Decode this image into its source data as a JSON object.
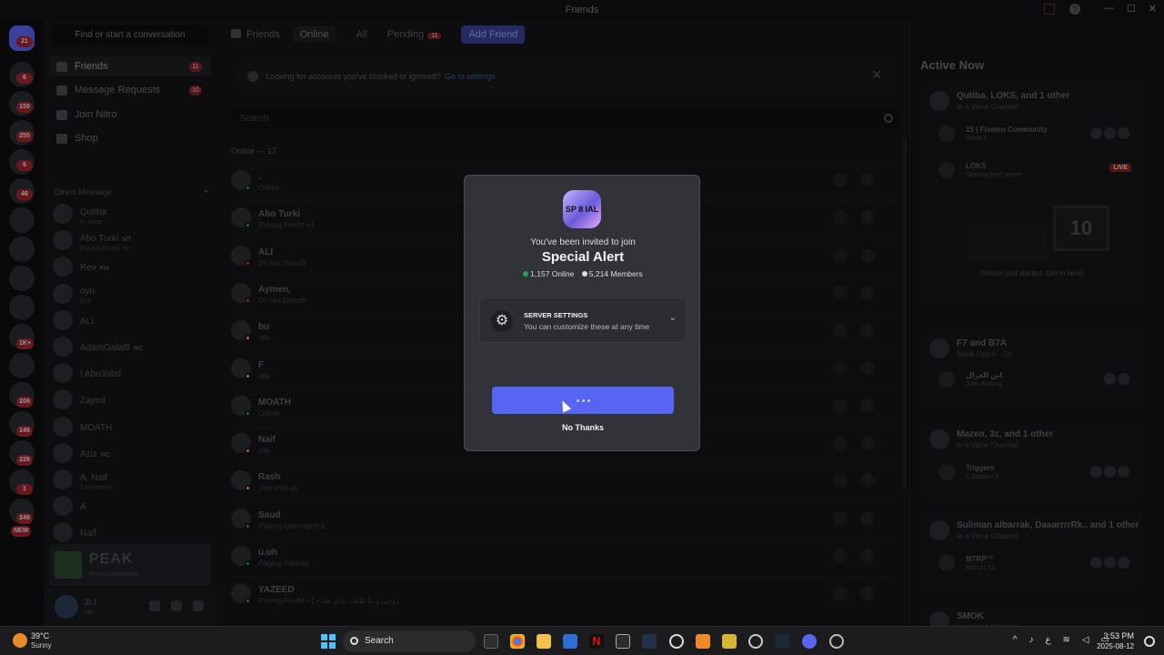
{
  "window": {
    "title": "Friends",
    "minimize": "—",
    "maximize": "☐",
    "close": "✕"
  },
  "rail": {
    "badges": [
      "21",
      "6",
      "159",
      "255",
      "6",
      "46",
      "1K+",
      "206",
      "146",
      "226",
      "1",
      "248"
    ],
    "new_label": "NEW"
  },
  "sidebar": {
    "search_placeholder": "Find or start a conversation",
    "nav": [
      {
        "label": "Friends",
        "badge": "11"
      },
      {
        "label": "Message Requests",
        "badge": "10"
      },
      {
        "label": "Join Nitro",
        "badge": ""
      },
      {
        "label": "Shop",
        "badge": ""
      }
    ],
    "dm_header": "Direct Message",
    "dm_add": "+",
    "dms": [
      {
        "name": "Qutiba",
        "sub": "In voice",
        "tag": ""
      },
      {
        "name": "Abo Turki",
        "sub": "Playing FiveM +1",
        "tag": "MT"
      },
      {
        "name": "Rev",
        "sub": "",
        "tag": "For"
      },
      {
        "name": "oyn",
        "sub": "619",
        "tag": ""
      },
      {
        "name": "ALI",
        "sub": "",
        "tag": ""
      },
      {
        "name": "AdamGalal8",
        "sub": "",
        "tag": "RC"
      },
      {
        "name": "! Abo3abd",
        "sub": "",
        "tag": ""
      },
      {
        "name": "Zayed .",
        "sub": "",
        "tag": ""
      },
      {
        "name": "MOATH",
        "sub": "",
        "tag": ""
      },
      {
        "name": "Aziz",
        "sub": "",
        "tag": "RC"
      },
      {
        "name": "A, Naif",
        "sub": "3 Members",
        "tag": ""
      },
      {
        "name": "A",
        "sub": "",
        "tag": ""
      },
      {
        "name": "Naif",
        "sub": "",
        "tag": ""
      },
      {
        "name": "M.F",
        "sub": "",
        "tag": "611"
      }
    ],
    "promo": {
      "title": "PEAK",
      "sub": "Reward Available"
    },
    "user": {
      "name": "3LI",
      "status": "Idle"
    }
  },
  "main": {
    "tabs": {
      "friends": "Friends",
      "online": "Online",
      "all": "All",
      "pending": "Pending",
      "pending_badge": "11",
      "add": "Add Friend"
    },
    "notice": {
      "text": "Looking for accounts you've blocked or ignored?",
      "link": "Go to settings",
      "close": "✕"
    },
    "search_placeholder": "Search",
    "online_header": "Online — 17",
    "friends": [
      {
        "name": ".",
        "status": "Online",
        "dot": "#23a55a"
      },
      {
        "name": "Abo Turki",
        "status": "Playing FiveM +1",
        "dot": "#23a55a"
      },
      {
        "name": "ALI",
        "status": "Do Not Disturb",
        "dot": "#da373c"
      },
      {
        "name": "Aymen,",
        "status": "Do Not Disturb",
        "dot": "#da373c"
      },
      {
        "name": "bu",
        "status": "Idle",
        "dot": "#f0b232"
      },
      {
        "name": "F",
        "status": "Idle",
        "dot": "#f0b232"
      },
      {
        "name": "MOATH",
        "status": "Online",
        "dot": "#23a55a"
      },
      {
        "name": "Naif",
        "status": "Idle",
        "dot": "#f0b232"
      },
      {
        "name": "Rash",
        "status": "Just shut up",
        "dot": "#f0b232"
      },
      {
        "name": "Saud",
        "status": "Playing Overwatch 2",
        "dot": "#23a55a"
      },
      {
        "name": "u.uh",
        "status": "Playing Fortnite",
        "dot": "#23a55a"
      },
      {
        "name": "YAZEED",
        "status": "Playing FiveM +1 • روحي و ما ملكت يداي هذا",
        "dot": "#23a55a"
      }
    ]
  },
  "active_now": {
    "title": "Active Now",
    "cards": [
      {
        "name": "Qutiba, LOKS, and 1 other",
        "sub": "In a Voice Channel",
        "inner": [
          {
            "name": "15 | Fiveten Community",
            "sub": "Voice 1",
            "live": ""
          },
          {
            "name": "LOKS",
            "sub": "Sharing their screen",
            "live": "LIVE"
          }
        ],
        "stream_caption": "Stream just started. Get in here!",
        "stream_number": "10"
      },
      {
        "name": "F7 and B7A",
        "sub": "Black Ops 6 – 2h",
        "inner": [
          {
            "name": "ابن العزال",
            "sub": "Just chatting",
            "live": ""
          }
        ]
      },
      {
        "name": "Mazen, 3z, and 1 other",
        "sub": "In a Voice Channel",
        "inner": [
          {
            "name": "Triggers",
            "sub": "1 Support 6",
            "live": ""
          }
        ]
      },
      {
        "name": "Suliman albarrak, DaaarrrrRk., and 1 other",
        "sub": "In a Voice Channel",
        "inner": [
          {
            "name": "MTRP™",
            "sub": "Assist | 11",
            "live": ""
          }
        ]
      },
      {
        "name": "SMOK",
        "sub": "In a Voice Channel",
        "inner": []
      }
    ]
  },
  "modal": {
    "server_icon_text": "SP 8 IAL",
    "invited": "You've been invited to join",
    "server_name": "Special Alert",
    "online": "1,157 Online",
    "members": "5,214 Members",
    "settings_title": "SERVER SETTINGS",
    "settings_sub": "You can customize these at any time",
    "no_thanks": "No Thanks",
    "accent": "#5865f2"
  },
  "taskbar": {
    "temp": "39°C",
    "weather": "Sunny",
    "search": "Search",
    "time": "3:53 PM",
    "date": "2025-08-12",
    "lang": "ع"
  }
}
